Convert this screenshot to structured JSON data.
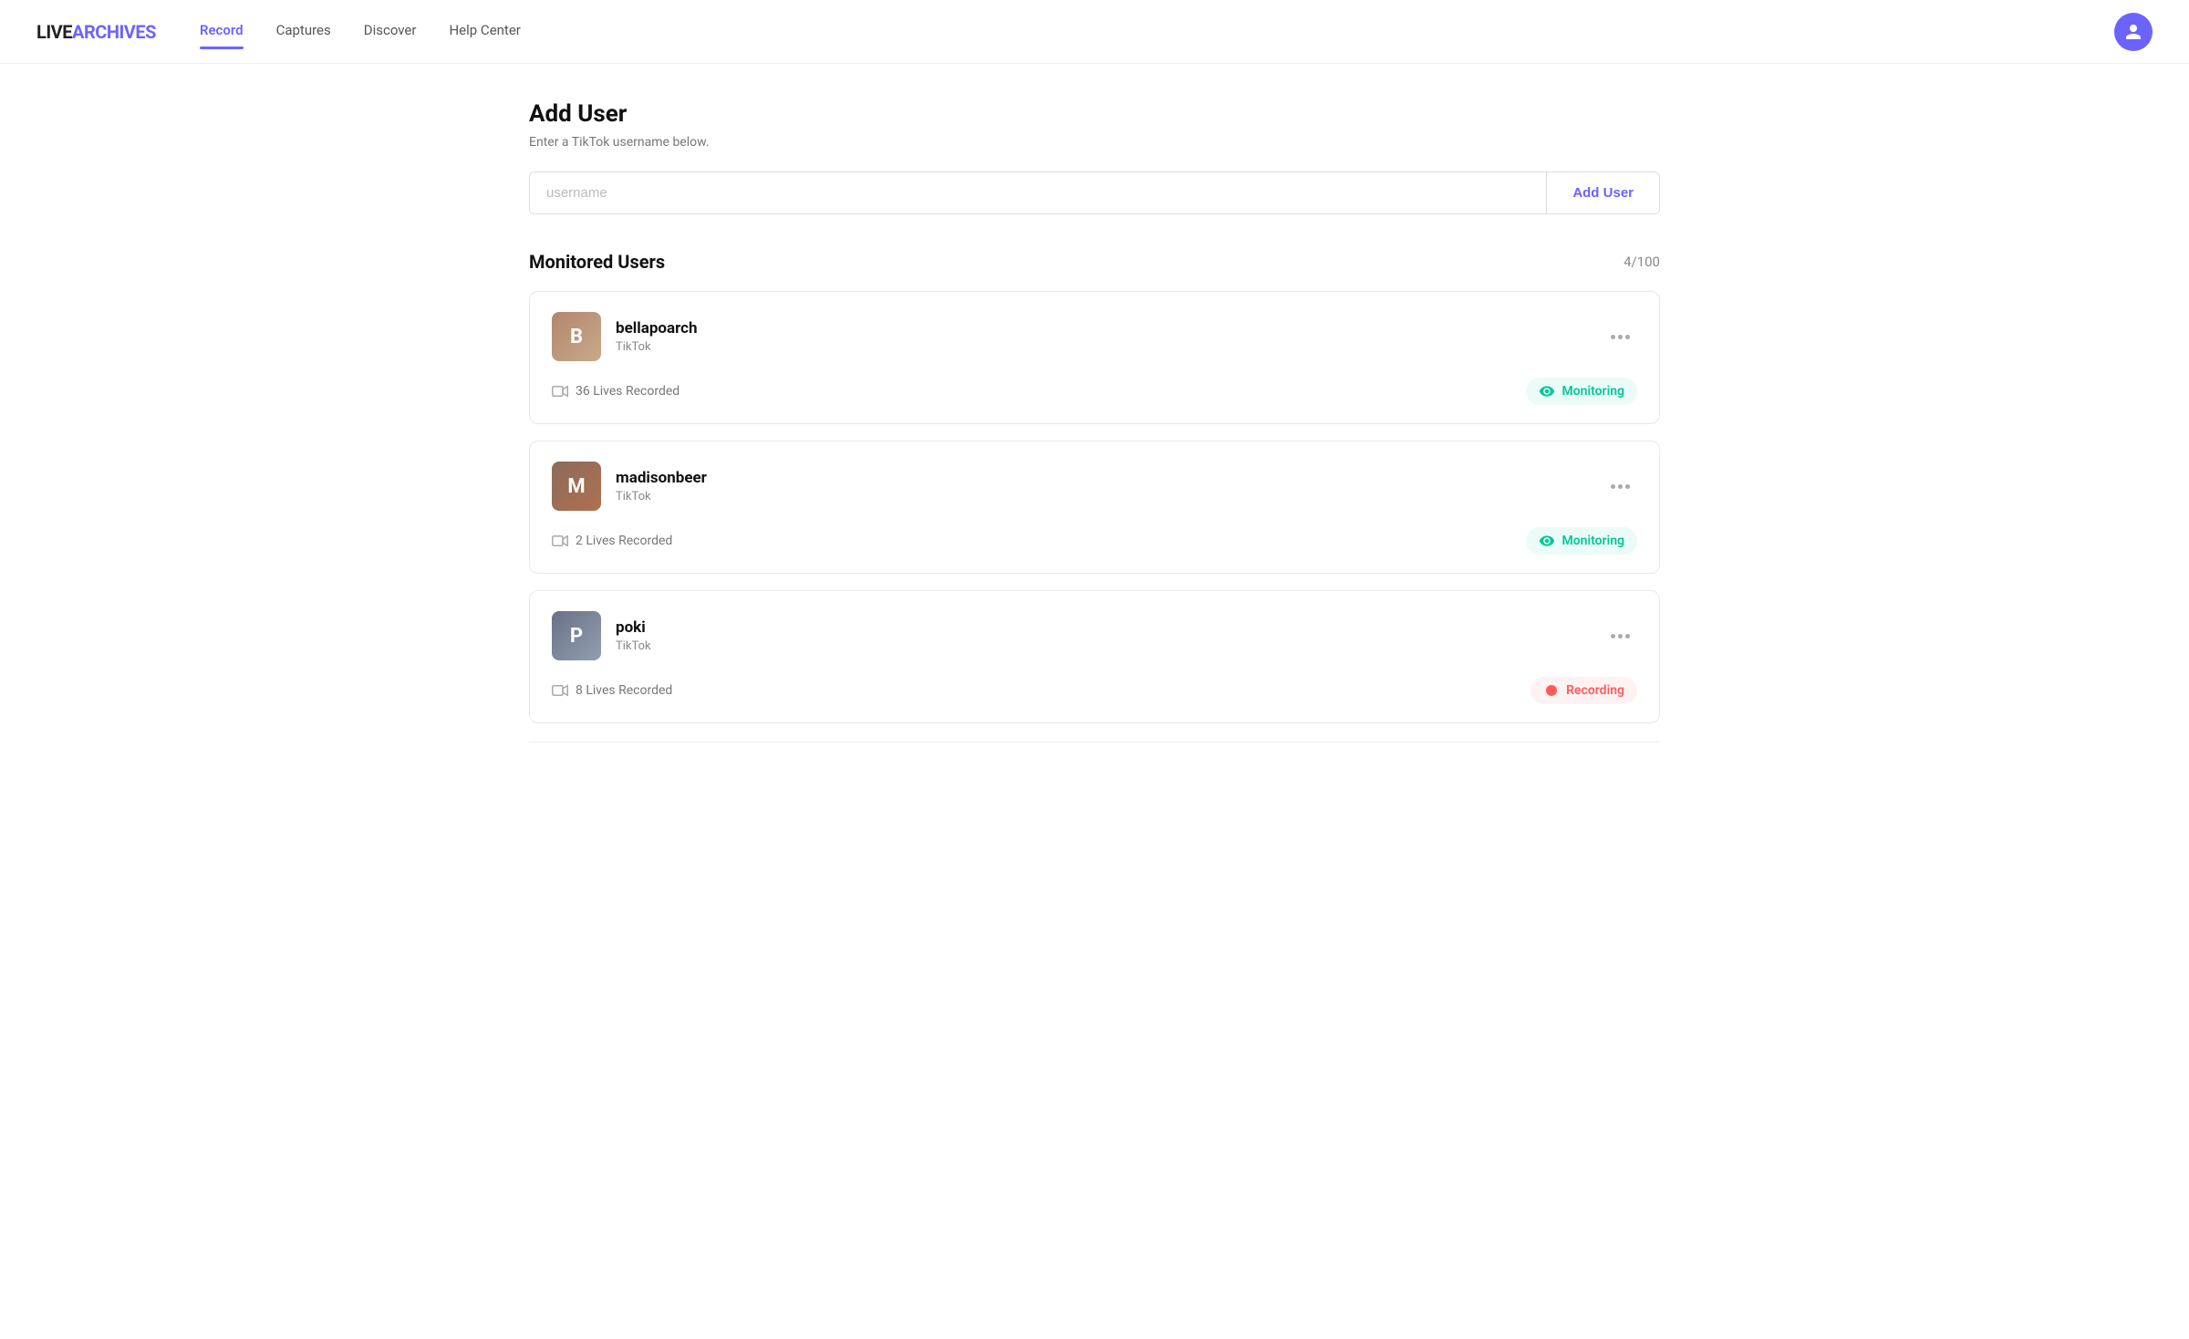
{
  "header": {
    "logo_live": "LIVE",
    "logo_archives": "ARCHIVES",
    "nav": [
      {
        "id": "record",
        "label": "Record",
        "active": true
      },
      {
        "id": "captures",
        "label": "Captures",
        "active": false
      },
      {
        "id": "discover",
        "label": "Discover",
        "active": false
      },
      {
        "id": "help",
        "label": "Help Center",
        "active": false
      }
    ]
  },
  "addUser": {
    "title": "Add User",
    "subtitle": "Enter a TikTok username below.",
    "input_placeholder": "username",
    "button_label": "Add User"
  },
  "monitoredUsers": {
    "title": "Monitored Users",
    "count": "4/100",
    "users": [
      {
        "id": "bellapoarch",
        "name": "bellapoarch",
        "platform": "TikTok",
        "avatar_label": "B",
        "avatar_class": "avatar-bellapoarch",
        "lives_recorded": "36 Lives Recorded",
        "status": "Monitoring",
        "status_type": "monitoring"
      },
      {
        "id": "madisonbeer",
        "name": "madisonbeer",
        "platform": "TikTok",
        "avatar_label": "M",
        "avatar_class": "avatar-madisonbeer",
        "lives_recorded": "2 Lives Recorded",
        "status": "Monitoring",
        "status_type": "monitoring"
      },
      {
        "id": "poki",
        "name": "poki",
        "platform": "TikTok",
        "avatar_label": "P",
        "avatar_class": "avatar-poki",
        "lives_recorded": "8 Lives Recorded",
        "status": "Recording",
        "status_type": "recording"
      }
    ]
  },
  "icons": {
    "video_camera": "📹",
    "eye": "👁",
    "record": "🔴"
  }
}
